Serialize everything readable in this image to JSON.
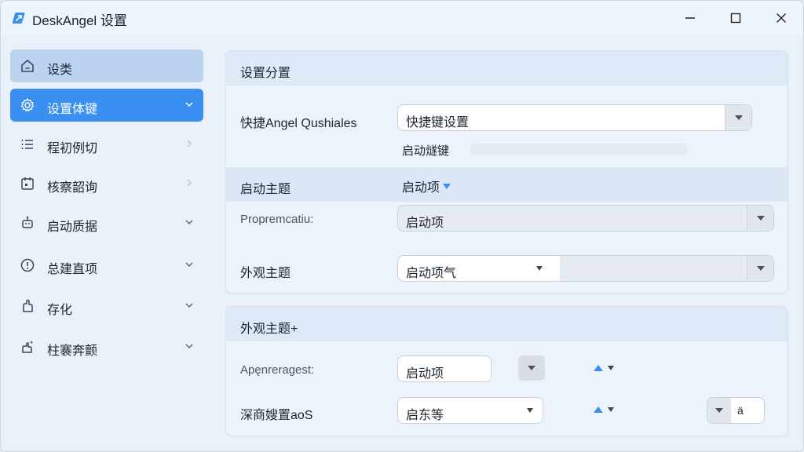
{
  "window": {
    "title": "DeskAngel 设置",
    "icon": "rocket-icon"
  },
  "sidebar": {
    "items": [
      {
        "label": "设类",
        "icon": "home-icon",
        "state": "selected-light",
        "chevron": "none"
      },
      {
        "label": "设置体键",
        "icon": "gear-icon",
        "state": "selected",
        "chevron": "down"
      },
      {
        "label": "程初例切",
        "icon": "list-icon",
        "state": "normal",
        "chevron": "right"
      },
      {
        "label": "核察韶询",
        "icon": "calendar-icon",
        "state": "normal",
        "chevron": "right"
      },
      {
        "label": "启动质据",
        "icon": "robot-icon",
        "state": "normal",
        "chevron": "down"
      },
      {
        "label": "总建直项",
        "icon": "info-icon",
        "state": "normal",
        "chevron": "down"
      },
      {
        "label": "存化",
        "icon": "hand-icon",
        "state": "normal",
        "chevron": "down"
      },
      {
        "label": "柱褰奔颤",
        "icon": "sparkle-hand-icon",
        "state": "normal",
        "chevron": "down"
      }
    ]
  },
  "card1": {
    "title": "设置分置",
    "rows": {
      "shortcut_label": "快捷Angel Qushiales",
      "shortcut_value": "快捷键设置",
      "shortcut_sub": "启动燧键",
      "theme_label": "启动主题",
      "theme_value": "启动项",
      "prop_label": "Propremcatiu:",
      "prop_value": "启动项",
      "appearance_label": "外观主题",
      "appearance_value": "启动项气"
    }
  },
  "card2": {
    "title": "外观主题+",
    "rows": {
      "app_label": "Apęnreragest:",
      "app_value": "启动项",
      "deep_label": "深商嫂置aoS",
      "deep_value": "启东等",
      "deep_num": "ä"
    }
  },
  "colors": {
    "accent": "#3a8ff0",
    "selected_light": "#b9d3f1",
    "window_bg": "#eaf1f9"
  }
}
